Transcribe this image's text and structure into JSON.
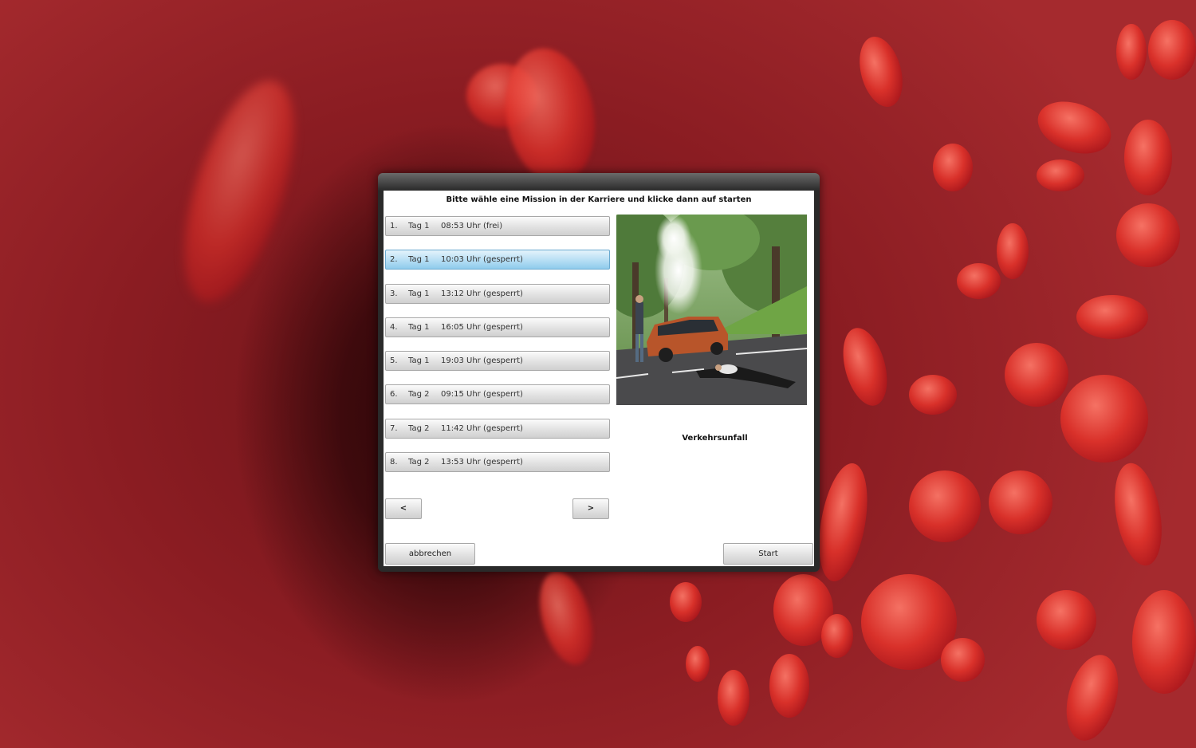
{
  "dialog": {
    "instruction": "Bitte wähle eine Mission in der Karriere und klicke dann auf starten",
    "missions": [
      {
        "num": "1.",
        "day": "Tag 1",
        "time": "08:53 Uhr (frei)",
        "selected": false
      },
      {
        "num": "2.",
        "day": "Tag 1",
        "time": "10:03 Uhr (gesperrt)",
        "selected": true
      },
      {
        "num": "3.",
        "day": "Tag 1",
        "time": "13:12 Uhr (gesperrt)",
        "selected": false
      },
      {
        "num": "4.",
        "day": "Tag 1",
        "time": "16:05 Uhr (gesperrt)",
        "selected": false
      },
      {
        "num": "5.",
        "day": "Tag 1",
        "time": "19:03 Uhr (gesperrt)",
        "selected": false
      },
      {
        "num": "6.",
        "day": "Tag 2",
        "time": "09:15 Uhr (gesperrt)",
        "selected": false
      },
      {
        "num": "7.",
        "day": "Tag 2",
        "time": "11:42 Uhr (gesperrt)",
        "selected": false
      },
      {
        "num": "8.",
        "day": "Tag 2",
        "time": "13:53 Uhr (gesperrt)",
        "selected": false
      }
    ],
    "prev_label": "<",
    "next_label": ">",
    "preview_caption": "Verkehrsunfall",
    "cancel_label": "abbrechen",
    "start_label": "Start"
  },
  "colors": {
    "selected_top": "#e4f3fb",
    "selected_bottom": "#8fcbec",
    "background_red": "#8a1c22"
  }
}
